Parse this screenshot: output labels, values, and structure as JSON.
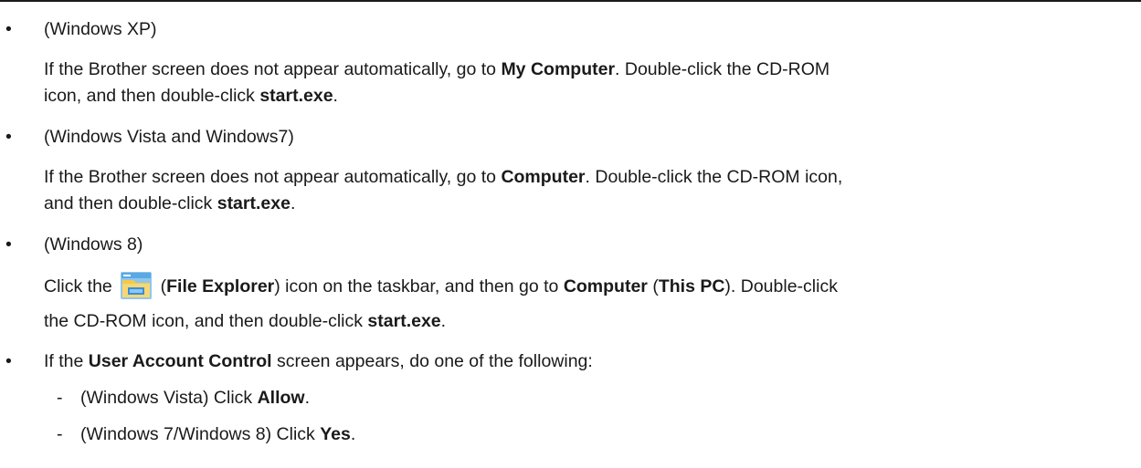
{
  "sections": [
    {
      "heading": "(Windows XP)",
      "text": [
        {
          "t": "If the Brother screen does not appear automatically, go to "
        },
        {
          "b": "My Computer"
        },
        {
          "t": ". Double-click the CD-ROM"
        }
      ],
      "text2": [
        {
          "t": "icon, and then double-click "
        },
        {
          "b": "start.exe"
        },
        {
          "t": "."
        }
      ]
    },
    {
      "heading": "(Windows Vista and Windows7)",
      "text": [
        {
          "t": "If the Brother screen does not appear automatically, go to "
        },
        {
          "b": "Computer"
        },
        {
          "t": ". Double-click the CD-ROM icon,"
        }
      ],
      "text2": [
        {
          "t": "and then double-click "
        },
        {
          "b": "start.exe"
        },
        {
          "t": "."
        }
      ]
    },
    {
      "heading": "(Windows 8)",
      "text_before_icon": "Click the",
      "text_after_icon": [
        {
          "t": "("
        },
        {
          "b": "File Explorer"
        },
        {
          "t": ") icon on the taskbar, and then go to "
        },
        {
          "b": "Computer"
        },
        {
          "t": " ("
        },
        {
          "b": "This PC"
        },
        {
          "t": "). Double-click"
        }
      ],
      "text2": [
        {
          "t": "the CD-ROM icon, and then double-click "
        },
        {
          "b": "start.exe"
        },
        {
          "t": "."
        }
      ],
      "icon": "file-explorer-icon"
    },
    {
      "heading_parts": [
        {
          "t": "If the "
        },
        {
          "b": "User Account Control"
        },
        {
          "t": " screen appears, do one of the following:"
        }
      ],
      "items": [
        [
          {
            "t": "(Windows Vista) Click "
          },
          {
            "b": "Allow"
          },
          {
            "t": "."
          }
        ],
        [
          {
            "t": "(Windows 7/Windows 8) Click "
          },
          {
            "b": "Yes"
          },
          {
            "t": "."
          }
        ]
      ]
    }
  ],
  "bullet_char": "•",
  "dash_char": "-",
  "colors": {
    "text": "#1a1a1a",
    "rule": "#1a1a1a",
    "icon_folder": "#f2c94c",
    "icon_blue": "#3a8fd6"
  }
}
